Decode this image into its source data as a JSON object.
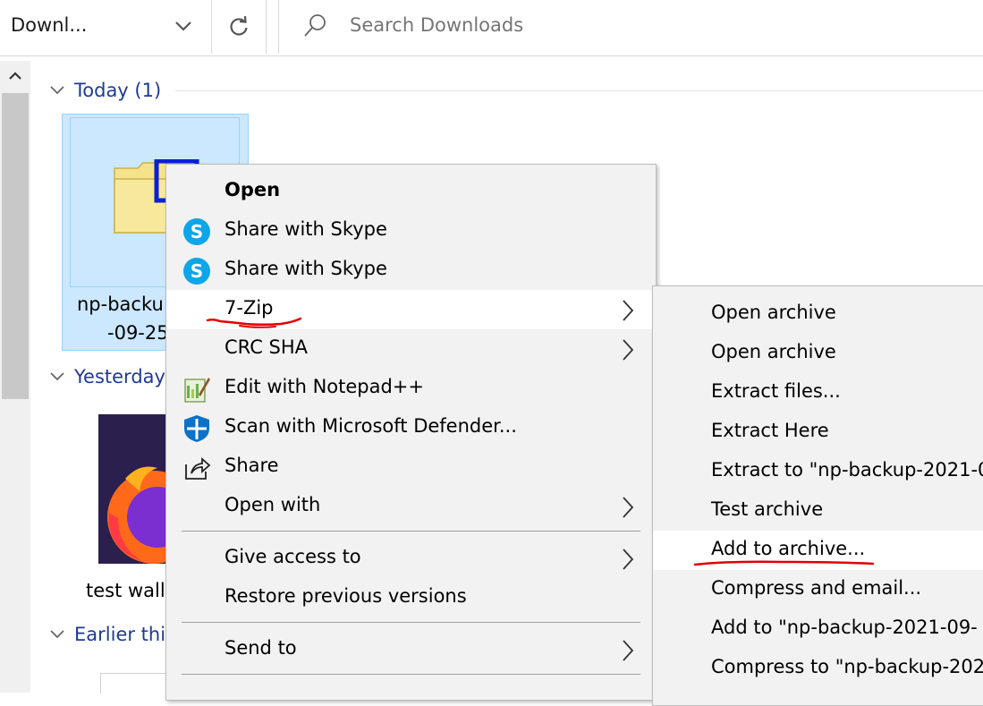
{
  "address": {
    "text": "Downl..."
  },
  "search": {
    "placeholder": "Search Downloads"
  },
  "groups": {
    "today": "Today (1)",
    "yesterday": "Yesterday",
    "earlier": "Earlier thi"
  },
  "files": [
    {
      "name_line1": "np-backu",
      "name_line2": "-09-25"
    },
    {
      "name": "test wall"
    }
  ],
  "context_menu": {
    "items": [
      {
        "label": "Open",
        "bold": true
      },
      {
        "label": "Share with Skype",
        "icon": "skype-icon"
      },
      {
        "label": "Share with Skype",
        "icon": "skype-icon"
      },
      {
        "label": "7-Zip",
        "submenu": true,
        "highlighted": true
      },
      {
        "label": "CRC SHA",
        "submenu": true
      },
      {
        "label": "Edit with Notepad++",
        "icon": "notepad-plus-plus-icon"
      },
      {
        "label": "Scan with Microsoft Defender...",
        "icon": "defender-shield-icon"
      },
      {
        "label": "Share",
        "icon": "share-icon"
      },
      {
        "label": "Open with",
        "submenu": true
      },
      {
        "label": "Give access to",
        "submenu": true
      },
      {
        "label": "Restore previous versions"
      },
      {
        "label": "Send to",
        "submenu": true
      }
    ]
  },
  "submenu_7zip": {
    "items": [
      {
        "label": "Open archive"
      },
      {
        "label": "Open archive"
      },
      {
        "label": "Extract files..."
      },
      {
        "label": "Extract Here"
      },
      {
        "label": "Extract to \"np-backup-2021-0"
      },
      {
        "label": "Test archive"
      },
      {
        "label": "Add to archive...",
        "highlighted": true
      },
      {
        "label": "Compress and email..."
      },
      {
        "label": "Add to \"np-backup-2021-09-"
      },
      {
        "label": "Compress to \"np-backup-202"
      }
    ]
  },
  "colors": {
    "group_header": "#1f3a93",
    "selection_bg": "#cce8ff",
    "annotation": "#e00000",
    "skype": "#0ea5e9"
  }
}
